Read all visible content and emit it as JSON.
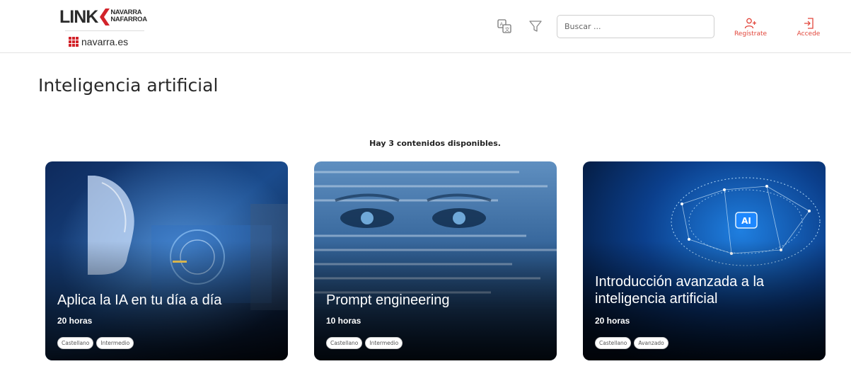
{
  "header": {
    "logo": {
      "word": "LINK",
      "sub_line1": "NAVARRA",
      "sub_line2": "NAFARROA",
      "domain": "navarra.es"
    },
    "search_placeholder": "Buscar ...",
    "register_label": "Regístrate",
    "login_label": "Accede",
    "icons": [
      "translate-icon",
      "filter-icon",
      "user-plus-icon",
      "login-icon"
    ]
  },
  "page": {
    "title": "Inteligencia artificial",
    "available_text": "Hay 3 contenidos disponibles."
  },
  "colors": {
    "accent": "#e2463b",
    "brand_red": "#d2232a"
  },
  "cards": [
    {
      "title": "Aplica la IA en tu día a día",
      "hours": "20 horas",
      "tags": [
        "Castellano",
        "Intermedio"
      ]
    },
    {
      "title": "Prompt engineering",
      "hours": "10 horas",
      "tags": [
        "Castellano",
        "Intermedio"
      ]
    },
    {
      "title": "Introducción avanzada a la inteligencia artificial",
      "hours": "20 horas",
      "tags": [
        "Castellano",
        "Avanzado"
      ]
    }
  ]
}
